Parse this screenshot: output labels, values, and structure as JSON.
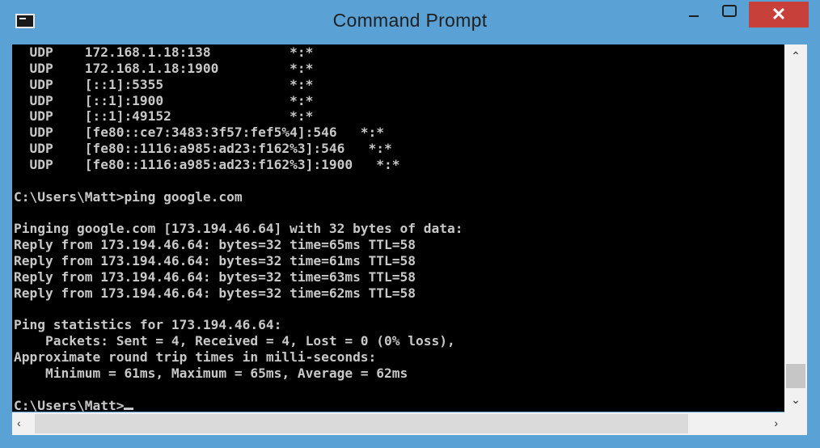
{
  "window": {
    "title": "Command Prompt",
    "minimize_icon": "minimize-icon",
    "maximize_icon": "maximize-icon",
    "close_label": "✕"
  },
  "console": {
    "lines": [
      "  UDP    172.168.1.18:138          *:*",
      "  UDP    172.168.1.18:1900         *:*",
      "  UDP    [::1]:5355                *:*",
      "  UDP    [::1]:1900                *:*",
      "  UDP    [::1]:49152               *:*",
      "  UDP    [fe80::ce7:3483:3f57:fef5%4]:546   *:*",
      "  UDP    [fe80::1116:a985:ad23:f162%3]:546   *:*",
      "  UDP    [fe80::1116:a985:ad23:f162%3]:1900   *:*",
      "",
      "C:\\Users\\Matt>ping google.com",
      "",
      "Pinging google.com [173.194.46.64] with 32 bytes of data:",
      "Reply from 173.194.46.64: bytes=32 time=65ms TTL=58",
      "Reply from 173.194.46.64: bytes=32 time=61ms TTL=58",
      "Reply from 173.194.46.64: bytes=32 time=63ms TTL=58",
      "Reply from 173.194.46.64: bytes=32 time=62ms TTL=58",
      "",
      "Ping statistics for 173.194.46.64:",
      "    Packets: Sent = 4, Received = 4, Lost = 0 (0% loss),",
      "Approximate round trip times in milli-seconds:",
      "    Minimum = 61ms, Maximum = 65ms, Average = 62ms",
      "",
      "C:\\Users\\Matt>"
    ]
  },
  "scrollbars": {
    "vertical": {
      "up_icon": "chevron-up-icon",
      "down_icon": "chevron-down-icon"
    },
    "horizontal": {
      "left_icon": "chevron-left-icon",
      "right_icon": "chevron-right-icon"
    }
  },
  "colors": {
    "frame": "#5aa2d6",
    "console_bg": "#000000",
    "console_text": "#c8c8c8",
    "close_button": "#c8403a"
  }
}
